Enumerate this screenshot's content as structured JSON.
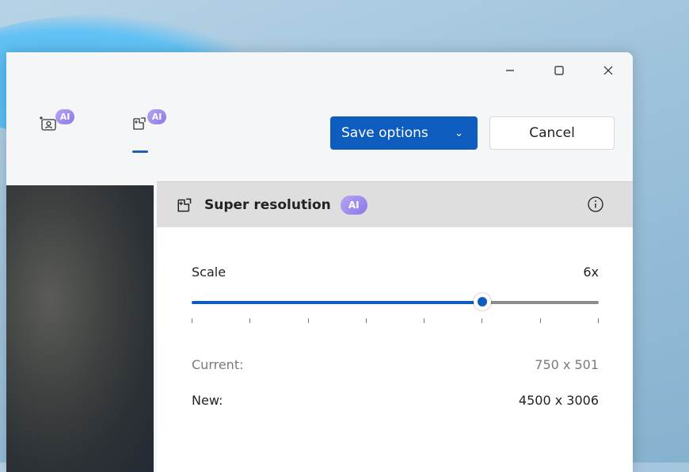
{
  "window_controls": [
    "minimize",
    "maximize",
    "close"
  ],
  "tools": [
    {
      "icon": "person-frame-sparkle-icon",
      "badge": "AI",
      "active": false
    },
    {
      "icon": "super-resolution-icon",
      "badge": "AI",
      "active": true
    }
  ],
  "save_button": {
    "label": "Save options"
  },
  "cancel_button": {
    "label": "Cancel"
  },
  "panel": {
    "title": "Super resolution",
    "badge": "AI",
    "scale": {
      "label": "Scale",
      "value": "6x",
      "min": 1,
      "max": 8,
      "current": 6
    },
    "current": {
      "label": "Current:",
      "value": "750 x 501"
    },
    "new": {
      "label": "New:",
      "value": "4500 x 3006"
    }
  },
  "colors": {
    "accent": "#0f5cbf",
    "ai_badge": "#9f8cf0",
    "panel_header": "#dedede"
  }
}
